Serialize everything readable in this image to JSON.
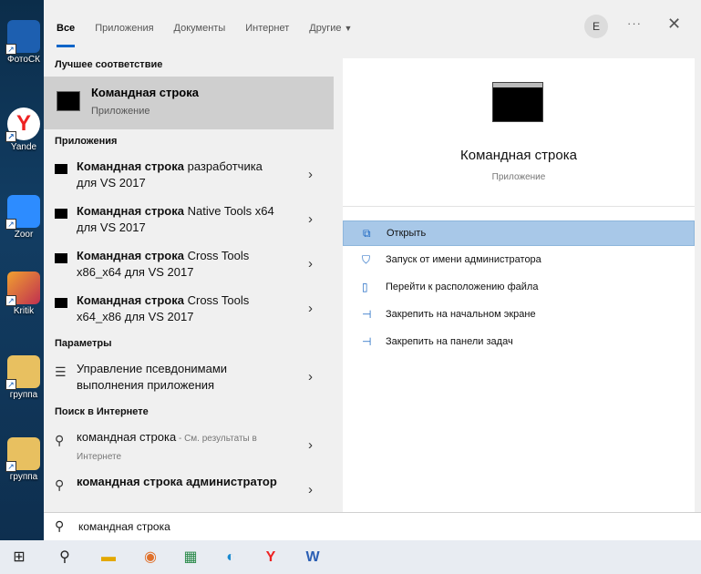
{
  "desktop": {
    "icons": [
      {
        "label": "ФотоСК"
      },
      {
        "label": "Yande"
      },
      {
        "label": "Zoor"
      },
      {
        "label": "Kritik"
      },
      {
        "label": "группа"
      },
      {
        "label": "группа"
      }
    ]
  },
  "tabs": [
    {
      "label": "Все"
    },
    {
      "label": "Приложения"
    },
    {
      "label": "Документы"
    },
    {
      "label": "Интернет"
    },
    {
      "label": "Другие"
    }
  ],
  "header": {
    "avatar": "E",
    "more": "···",
    "close": "✕",
    "caret": "▼"
  },
  "results": {
    "best_header": "Лучшее соответствие",
    "best": {
      "title": "Командная строка",
      "subtitle": "Приложение"
    },
    "apps_header": "Приложения",
    "apps": [
      {
        "bold": "Командная строка",
        "rest_line1": " разработчика",
        "line2": "для VS 2017"
      },
      {
        "bold": "Командная строка",
        "rest_line1": " Native Tools x64",
        "line2": "для VS 2017"
      },
      {
        "bold": "Командная строка",
        "rest_line1": " Cross Tools",
        "line2": "x86_x64 для VS 2017"
      },
      {
        "bold": "Командная строка",
        "rest_line1": " Cross Tools",
        "line2": "x64_x86 для VS 2017"
      }
    ],
    "params_header": "Параметры",
    "param": {
      "line1": "Управление псевдонимами",
      "line2": "выполнения приложения"
    },
    "web_header": "Поиск в Интернете",
    "web": [
      {
        "bold": "командная строка",
        "rest": " - См. результаты в",
        "line2": "Интернете"
      },
      {
        "bold": "командная строка администратор",
        "rest": "",
        "line2": ""
      }
    ]
  },
  "preview": {
    "title": "Командная строка",
    "subtitle": "Приложение",
    "actions": [
      {
        "label": "Открыть",
        "icon": "open-icon"
      },
      {
        "label": "Запуск от имени администратора",
        "icon": "shield-run-icon"
      },
      {
        "label": "Перейти к расположению файла",
        "icon": "file-location-icon"
      },
      {
        "label": "Закрепить на начальном экране",
        "icon": "pin-icon"
      },
      {
        "label": "Закрепить на панели задач",
        "icon": "pin-icon"
      }
    ]
  },
  "search": {
    "value": "командная строка"
  },
  "colors": {
    "accent": "#0a64c8",
    "selected": "#a8c8e8",
    "best_bg": "#cfcfcf"
  }
}
